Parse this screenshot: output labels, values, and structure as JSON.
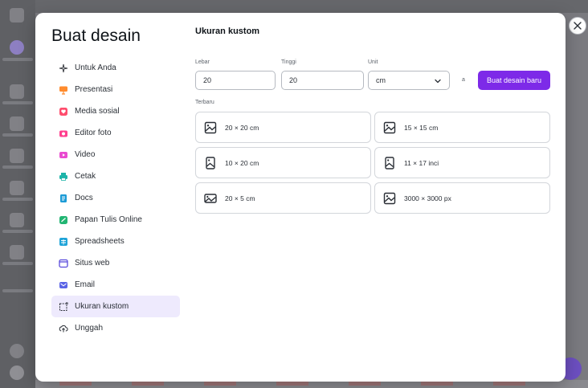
{
  "modal": {
    "title": "Buat desain",
    "menu": [
      {
        "label": "Untuk Anda",
        "icon": "sparkle-icon",
        "color": "#3c3f45"
      },
      {
        "label": "Presentasi",
        "icon": "presentation-icon",
        "color": "#ff8c2e"
      },
      {
        "label": "Media sosial",
        "icon": "heart-icon",
        "color": "#ff4d6d"
      },
      {
        "label": "Editor foto",
        "icon": "camera-icon",
        "color": "#ff3f8e"
      },
      {
        "label": "Video",
        "icon": "video-icon",
        "color": "#e94bd0"
      },
      {
        "label": "Cetak",
        "icon": "printer-icon",
        "color": "#1db4a9"
      },
      {
        "label": "Docs",
        "icon": "document-icon",
        "color": "#1c9bd6"
      },
      {
        "label": "Papan Tulis Online",
        "icon": "whiteboard-icon",
        "color": "#22b573"
      },
      {
        "label": "Spreadsheets",
        "icon": "spreadsheet-icon",
        "color": "#20a4d8"
      },
      {
        "label": "Situs web",
        "icon": "website-icon",
        "color": "#5a4cdb"
      },
      {
        "label": "Email",
        "icon": "email-icon",
        "color": "#5a64e6"
      },
      {
        "label": "Ukuran kustom",
        "icon": "custom-size-icon",
        "color": "#2a2f36"
      },
      {
        "label": "Unggah",
        "icon": "upload-icon",
        "color": "#2a2f36"
      }
    ],
    "active_index": 11
  },
  "custom": {
    "title": "Ukuran kustom",
    "width_label": "Lebar",
    "height_label": "Tinggi",
    "unit_label": "Unit",
    "width_value": "20",
    "height_value": "20",
    "unit_value": "cm",
    "lock_symbol": "a",
    "create_label": "Buat desain baru",
    "recent_label": "Terbaru",
    "recent": [
      {
        "label": "20 × 20 cm",
        "icon": "square-image-icon"
      },
      {
        "label": "15 × 15 cm",
        "icon": "square-image-icon"
      },
      {
        "label": "10 × 20 cm",
        "icon": "portrait-image-icon"
      },
      {
        "label": "11 × 17 inci",
        "icon": "portrait-image-icon"
      },
      {
        "label": "20 × 5 cm",
        "icon": "landscape-image-icon"
      },
      {
        "label": "3000 × 3000 px",
        "icon": "square-image-icon"
      }
    ]
  },
  "colors": {
    "accent": "#7d2ae8",
    "active_bg": "#eeeafd"
  }
}
